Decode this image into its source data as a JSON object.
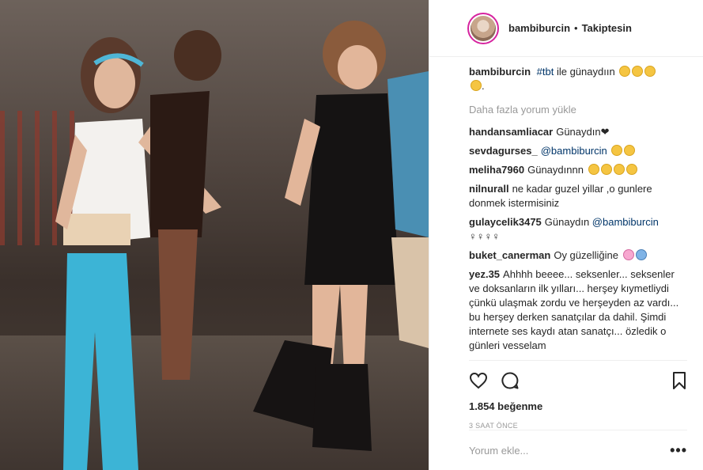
{
  "post": {
    "author": "bambiburcin",
    "follow_label": "Takiptesin",
    "separator": "•",
    "caption_user": "bambiburcin",
    "caption_tag": "#tbt",
    "caption_text": "ile günaydıın",
    "caption_end": "."
  },
  "comments": {
    "load_more": "Daha fazla yorum yükle",
    "items": [
      {
        "user": "handansamliacar",
        "text": "Günaydın❤"
      },
      {
        "user": "sevdagurses_",
        "text": "@bambiburcin"
      },
      {
        "user": "meliha7960",
        "text": "Günaydınnn"
      },
      {
        "user": "nilnurall",
        "text": "ne kadar guzel yillar ,o gunlere donmek istermisiniz"
      },
      {
        "user": "gulaycelik3475",
        "text": "Günaydın",
        "tag": "@bambiburcin"
      },
      {
        "user": "buket_canerman",
        "text": "Oy güzelliğine"
      },
      {
        "user": "yez.35",
        "text": "Ahhhh beeee... seksenler... seksenler ve doksanların ilk yılları... herşey kıymetliydi çünkü ulaşmak zordu ve herşeyden az vardı... bu herşey derken sanatçılar da dahil. Şimdi internete ses kaydı atan sanatçı... özledik o günleri vesselam"
      }
    ]
  },
  "actions": {
    "likes": "1.854 beğenme",
    "time": "3 SAAT ÖNCE"
  },
  "input": {
    "placeholder": "Yorum ekle...",
    "more": "•••"
  },
  "icons": {
    "like": "heart-icon",
    "comment": "comment-icon",
    "save": "bookmark-icon"
  }
}
